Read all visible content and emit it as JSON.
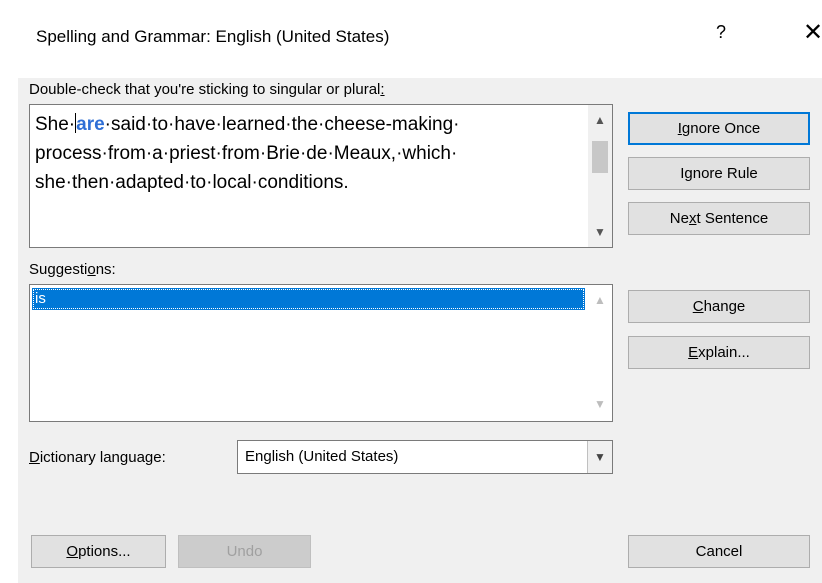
{
  "window": {
    "title": "Spelling and Grammar: English (United States)",
    "help_label": "?",
    "close_label": "✕"
  },
  "issue": {
    "heading_pre": "Double-check that you're sticking to singular or plural",
    "heading_colon": ":",
    "sentence_pre": "She·",
    "sentence_error": "are",
    "sentence_post_line1": "·said·to·have·learned·the·cheese-making·",
    "sentence_line2": "process·from·a·priest·from·Brie·de·Meaux,·which·",
    "sentence_line3": "she·then·adapted·to·local·conditions."
  },
  "suggestions": {
    "label_pre": "Suggesti",
    "label_u": "o",
    "label_post": "ns:",
    "items": [
      "is"
    ]
  },
  "dictionary": {
    "label_u": "D",
    "label_post": "ictionary language:",
    "value": "English (United States)"
  },
  "buttons": {
    "ignore_once_u": "I",
    "ignore_once_post": "gnore Once",
    "ignore_rule_pre": "I",
    "ignore_rule_u": "g",
    "ignore_rule_post": "nore Rule",
    "next_sentence_pre": "Ne",
    "next_sentence_u": "x",
    "next_sentence_post": "t Sentence",
    "change_u": "C",
    "change_post": "hange",
    "explain_u": "E",
    "explain_post": "xplain...",
    "options_u": "O",
    "options_post": "ptions...",
    "undo": "Undo",
    "cancel": "Cancel"
  },
  "icons": {
    "scroll_up": "▲",
    "scroll_down": "▼",
    "dropdown": "▼"
  },
  "colors": {
    "accent": "#0078d7",
    "error_text": "#2f6fd6"
  }
}
